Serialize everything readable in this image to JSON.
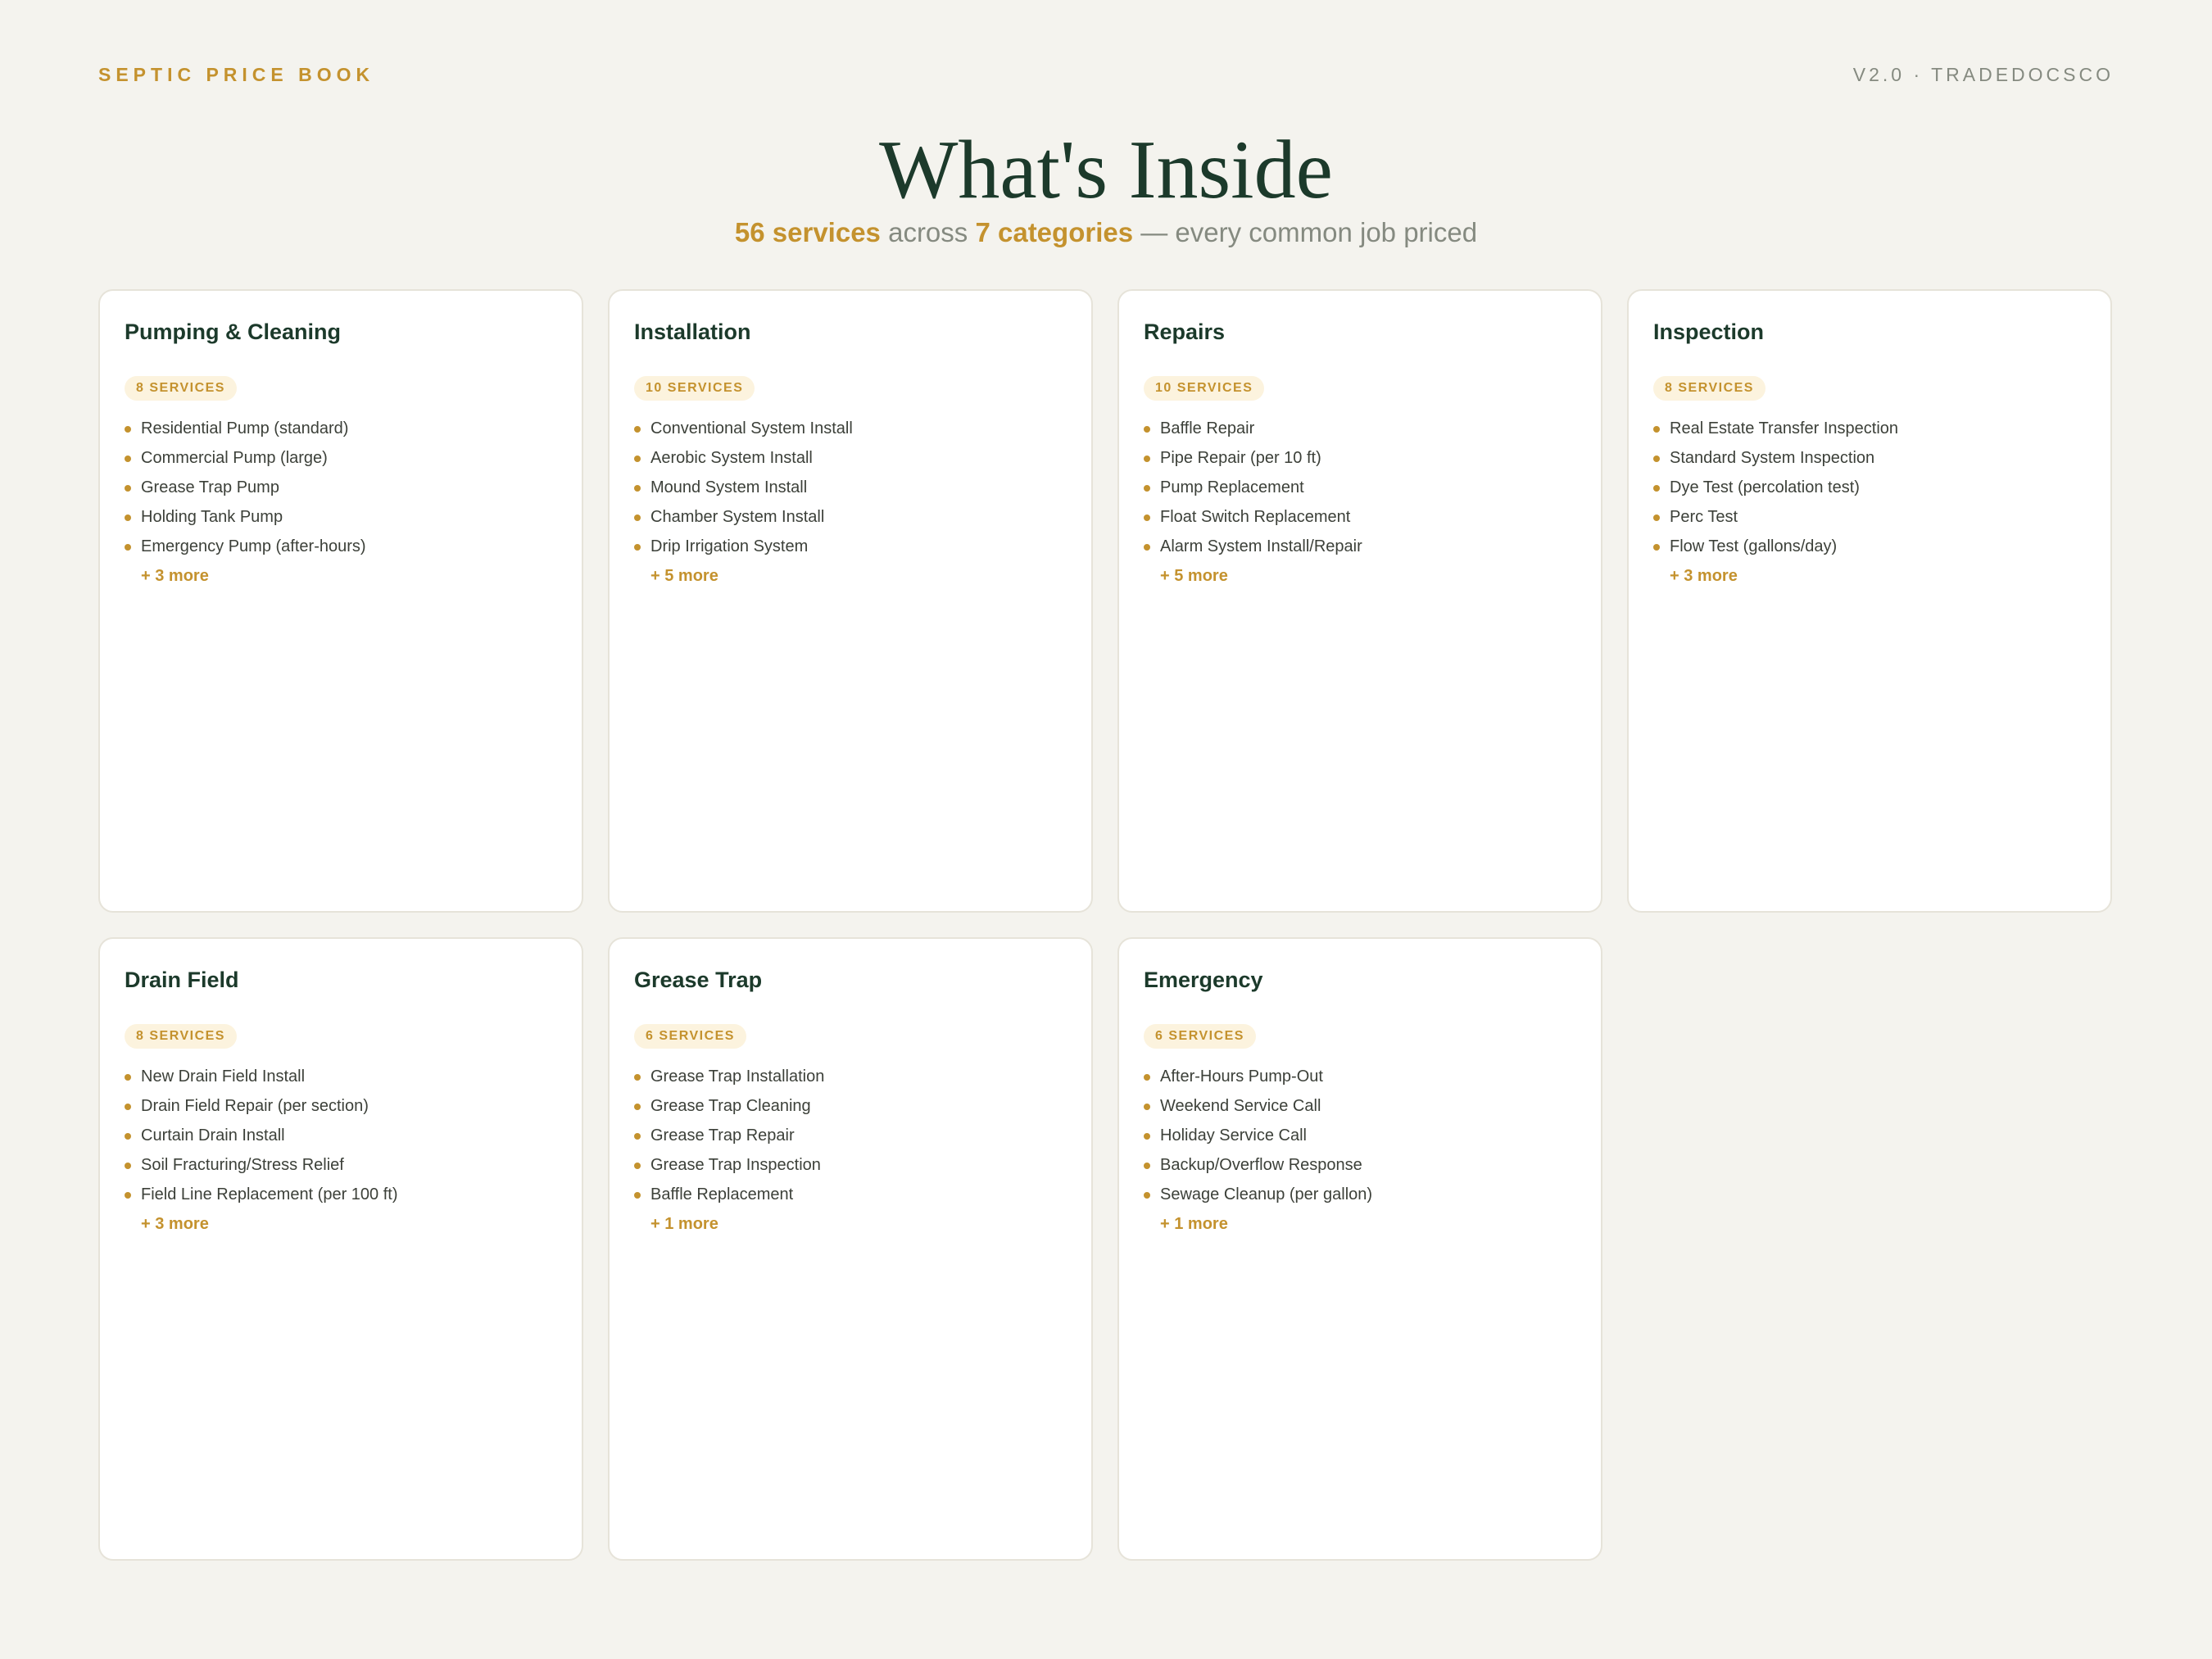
{
  "header": {
    "brand": "SEPTIC PRICE BOOK",
    "version": "V2.0 · TRADEDOCSCO"
  },
  "title": "What's Inside",
  "subtitle": {
    "services": "56 services",
    "across": " across ",
    "categories": "7 categories",
    "rest": " — every common job priced"
  },
  "colors": {
    "accent": "#c4922e",
    "heading": "#1c3a2b",
    "background": "#f4f3ee"
  },
  "categories": [
    {
      "name": "Pumping & Cleaning",
      "badge": "8 SERVICES",
      "items": [
        "Residential Pump (standard)",
        "Commercial Pump (large)",
        "Grease Trap Pump",
        "Holding Tank Pump",
        "Emergency Pump (after-hours)"
      ],
      "more": "+ 3 more"
    },
    {
      "name": "Installation",
      "badge": "10 SERVICES",
      "items": [
        "Conventional System Install",
        "Aerobic System Install",
        "Mound System Install",
        "Chamber System Install",
        "Drip Irrigation System"
      ],
      "more": "+ 5 more"
    },
    {
      "name": "Repairs",
      "badge": "10 SERVICES",
      "items": [
        "Baffle Repair",
        "Pipe Repair (per 10 ft)",
        "Pump Replacement",
        "Float Switch Replacement",
        "Alarm System Install/Repair"
      ],
      "more": "+ 5 more"
    },
    {
      "name": "Inspection",
      "badge": "8 SERVICES",
      "items": [
        "Real Estate Transfer Inspection",
        "Standard System Inspection",
        "Dye Test (percolation test)",
        "Perc Test",
        "Flow Test (gallons/day)"
      ],
      "more": "+ 3 more"
    },
    {
      "name": "Drain Field",
      "badge": "8 SERVICES",
      "items": [
        "New Drain Field Install",
        "Drain Field Repair (per section)",
        "Curtain Drain Install",
        "Soil Fracturing/Stress Relief",
        "Field Line Replacement (per 100 ft)"
      ],
      "more": "+ 3 more"
    },
    {
      "name": "Grease Trap",
      "badge": "6 SERVICES",
      "items": [
        "Grease Trap Installation",
        "Grease Trap Cleaning",
        "Grease Trap Repair",
        "Grease Trap Inspection",
        "Baffle Replacement"
      ],
      "more": "+ 1 more"
    },
    {
      "name": "Emergency",
      "badge": "6 SERVICES",
      "items": [
        "After-Hours Pump-Out",
        "Weekend Service Call",
        "Holiday Service Call",
        "Backup/Overflow Response",
        "Sewage Cleanup (per gallon)"
      ],
      "more": "+ 1 more"
    }
  ]
}
